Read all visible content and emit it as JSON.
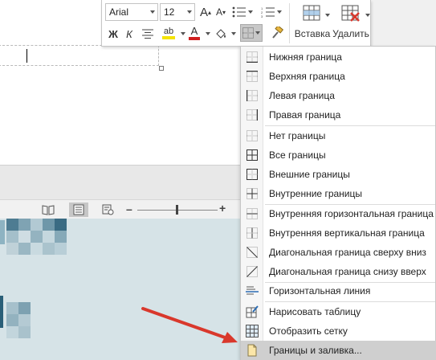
{
  "font": {
    "family_value": "Arial",
    "size_value": "12"
  },
  "toolbar": {
    "bold_label": "Ж",
    "italic_label": "К",
    "grow_font_label": "A",
    "shrink_font_label": "A",
    "highlight_label": "ab",
    "font_color_label": "A",
    "insert_label": "Вставка",
    "delete_label": "Удалить"
  },
  "menu": {
    "items": [
      {
        "label": "Нижняя граница",
        "icon": "border-bottom-icon"
      },
      {
        "label": "Верхняя граница",
        "icon": "border-top-icon"
      },
      {
        "label": "Левая граница",
        "icon": "border-left-icon"
      },
      {
        "label": "Правая граница",
        "icon": "border-right-icon"
      },
      {
        "label": "Нет границы",
        "icon": "border-none-icon"
      },
      {
        "label": "Все границы",
        "icon": "border-all-icon"
      },
      {
        "label": "Внешние границы",
        "icon": "border-outside-icon"
      },
      {
        "label": "Внутренние границы",
        "icon": "border-inside-icon"
      },
      {
        "label": "Внутренняя горизонтальная граница",
        "icon": "border-inside-horizontal-icon"
      },
      {
        "label": "Внутренняя вертикальная граница",
        "icon": "border-inside-vertical-icon"
      },
      {
        "label": "Диагональная граница сверху вниз",
        "icon": "border-diagonal-down-icon"
      },
      {
        "label": "Диагональная граница снизу вверх",
        "icon": "border-diagonal-up-icon"
      },
      {
        "label": "Горизонтальная линия",
        "icon": "horizontal-line-icon"
      },
      {
        "label": "Нарисовать таблицу",
        "icon": "draw-table-icon"
      },
      {
        "label": "Отобразить сетку",
        "icon": "view-gridlines-icon"
      },
      {
        "label": "Границы и заливка...",
        "icon": "borders-and-shading-icon"
      }
    ]
  },
  "colors": {
    "accent_red": "#d9382c",
    "highlight_yellow": "#f5e400",
    "font_color_red": "#d01f1f",
    "slide_background": "#d6e3e7",
    "menu_hover": "#cfcfcf"
  }
}
